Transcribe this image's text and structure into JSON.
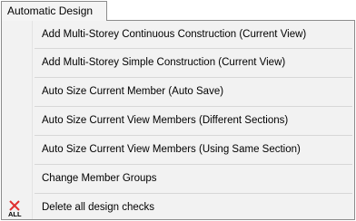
{
  "menu": {
    "title": "Automatic Design",
    "items": [
      {
        "label": "Add Multi-Storey Continuous Construction (Current View)"
      },
      {
        "label": "Add Multi-Storey Simple Construction (Current View)"
      },
      {
        "label": "Auto Size Current Member (Auto Save)"
      },
      {
        "label": "Auto Size Current View Members (Different Sections)"
      },
      {
        "label": "Auto Size Current View Members (Using Same Section)"
      },
      {
        "label": "Change Member Groups"
      },
      {
        "label": "Delete all design checks",
        "icon": "delete-all-icon"
      }
    ]
  },
  "icons": {
    "delete_all_text": "ALL",
    "delete_all_cross_color": "#e03030"
  }
}
